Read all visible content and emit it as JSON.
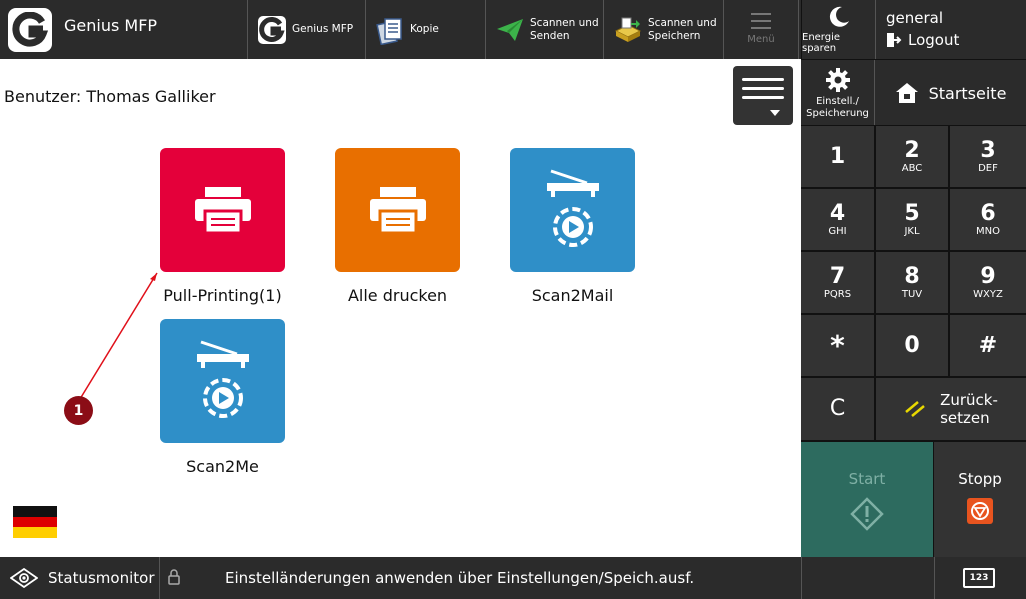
{
  "topbar": {
    "app_title": "Genius MFP",
    "tabs": [
      {
        "label": "Genius MFP",
        "icon": "genius-logo-icon"
      },
      {
        "label": "Kopie",
        "icon": "copy-icon"
      },
      {
        "label": "Scannen und Senden",
        "label_line1": "Scannen und",
        "label_line2": "Senden",
        "icon": "send-plane-icon"
      },
      {
        "label": "Scannen und Speichern",
        "label_line1": "Scannen und",
        "label_line2": "Speichern",
        "icon": "scan-store-icon"
      }
    ],
    "menu_label": "Menü"
  },
  "right_panel": {
    "energy_label": "Energie sparen",
    "user_name": "general",
    "logout_label": "Logout",
    "settings_label_line1": "Einstell./",
    "settings_label_line2": "Speicherung",
    "home_label": "Startseite"
  },
  "main": {
    "user_line": "Benutzer: Thomas Galliker",
    "apps": [
      {
        "label": "Pull-Printing(1)",
        "color": "#e4003a",
        "icon": "printer-icon"
      },
      {
        "label": "Alle drucken",
        "color": "#e86f00",
        "icon": "printer-icon"
      },
      {
        "label": "Scan2Mail",
        "color": "#2f8fc8",
        "icon": "scan-gear-icon"
      },
      {
        "label": "Scan2Me",
        "color": "#2f8fc8",
        "icon": "scan-gear-icon"
      }
    ],
    "annotation_badge": "1",
    "language_flag": "germany-flag"
  },
  "keypad": {
    "keys": [
      {
        "digit": "1",
        "letters": ""
      },
      {
        "digit": "2",
        "letters": "ABC"
      },
      {
        "digit": "3",
        "letters": "DEF"
      },
      {
        "digit": "4",
        "letters": "GHI"
      },
      {
        "digit": "5",
        "letters": "JKL"
      },
      {
        "digit": "6",
        "letters": "MNO"
      },
      {
        "digit": "7",
        "letters": "PQRS"
      },
      {
        "digit": "8",
        "letters": "TUV"
      },
      {
        "digit": "9",
        "letters": "WXYZ"
      },
      {
        "digit": "*",
        "letters": ""
      },
      {
        "digit": "0",
        "letters": ""
      },
      {
        "digit": "#",
        "letters": ""
      }
    ],
    "clear_label": "C",
    "reset_label_line1": "Zurück-",
    "reset_label_line2": "setzen",
    "start_label": "Start",
    "stop_label": "Stopp"
  },
  "statusbar": {
    "monitor_label": "Statusmonitor",
    "message": "Einstelländerungen anwenden über Einstellungen/Speich.ausf.",
    "keyboard_label": "123"
  },
  "colors": {
    "accent_red": "#e4003a",
    "accent_orange": "#e86f00",
    "accent_blue": "#2f8fc8",
    "start_green": "#2d6b5f",
    "stop_orange": "#e8541f",
    "reset_yellow": "#e8d800"
  }
}
